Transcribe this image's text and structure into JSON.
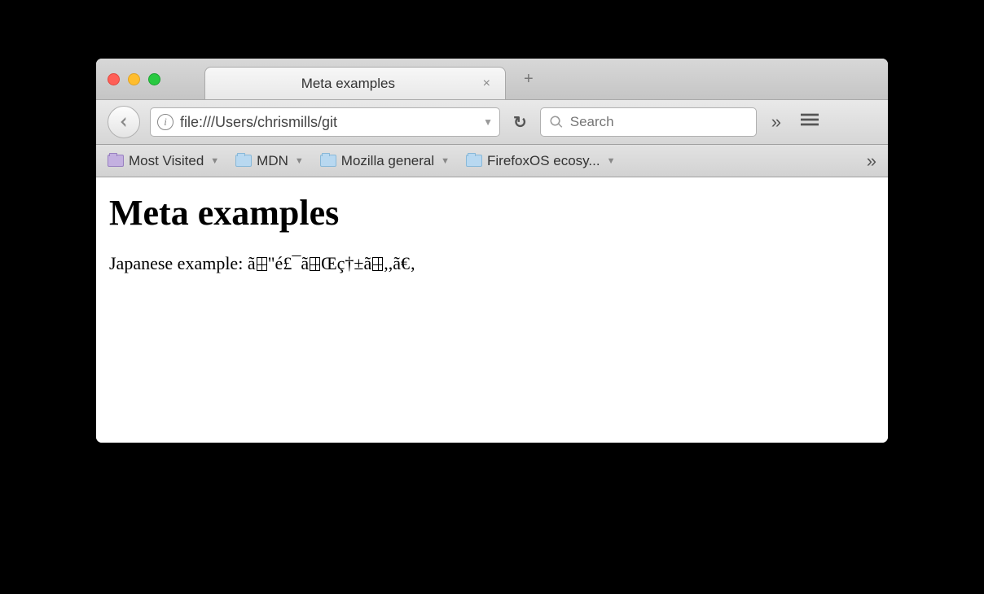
{
  "tab": {
    "title": "Meta examples"
  },
  "toolbar": {
    "url": "file:///Users/chrismills/git",
    "search_placeholder": "Search"
  },
  "bookmarks": {
    "items": [
      {
        "label": "Most Visited",
        "color": "purple"
      },
      {
        "label": "MDN",
        "color": "blue"
      },
      {
        "label": "Mozilla general",
        "color": "blue"
      },
      {
        "label": "FirefoxOS ecosy...",
        "color": "blue"
      }
    ]
  },
  "page": {
    "heading": "Meta examples",
    "paragraph_prefix": "Japanese example: ",
    "mojibake_parts": [
      "ã",
      "\"é£¯ã",
      "Œç†±ã",
      ",,ã€‚"
    ]
  }
}
